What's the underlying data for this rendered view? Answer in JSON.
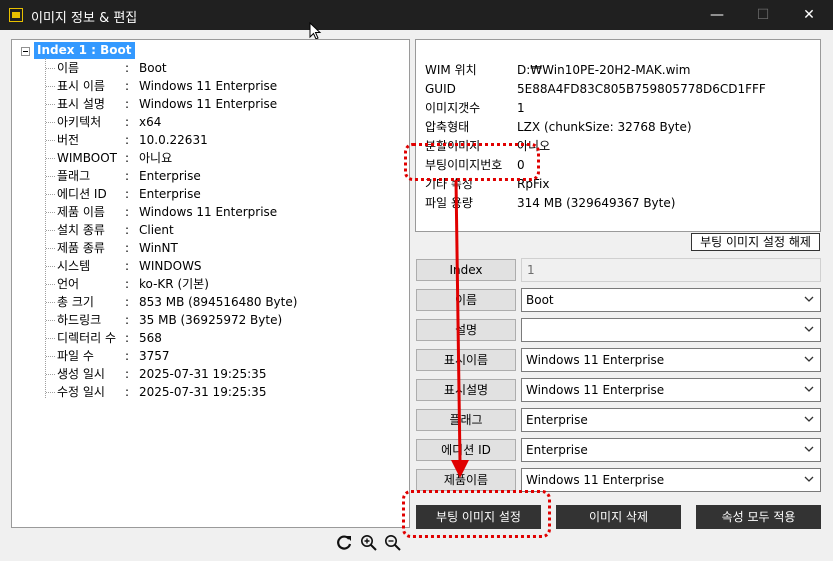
{
  "window": {
    "title": "이미지 정보 & 편집",
    "min": "—",
    "max": "☐",
    "close": "✕"
  },
  "tree": {
    "root": "Index 1 : Boot",
    "separator": ":",
    "items": [
      {
        "label": "이름",
        "value": "Boot"
      },
      {
        "label": "표시 이름",
        "value": "Windows 11 Enterprise"
      },
      {
        "label": "표시 설명",
        "value": "Windows 11 Enterprise"
      },
      {
        "label": "아키텍처",
        "value": "x64"
      },
      {
        "label": "버전",
        "value": "10.0.22631"
      },
      {
        "label": "WIMBOOT",
        "value": "아니요"
      },
      {
        "label": "플래그",
        "value": "Enterprise"
      },
      {
        "label": "에디션 ID",
        "value": "Enterprise"
      },
      {
        "label": "제품 이름",
        "value": "Windows 11 Enterprise"
      },
      {
        "label": "설치 종류",
        "value": "Client"
      },
      {
        "label": "제품 종류",
        "value": "WinNT"
      },
      {
        "label": "시스템",
        "value": "WINDOWS"
      },
      {
        "label": "언어",
        "value": "ko-KR (기본)"
      },
      {
        "label": "총 크기",
        "value": "853 MB  (894516480 Byte)"
      },
      {
        "label": "하드링크",
        "value": "35 MB  (36925972 Byte)"
      },
      {
        "label": "디렉터리 수",
        "value": "568"
      },
      {
        "label": "파일 수",
        "value": "3757"
      },
      {
        "label": "생성 일시",
        "value": "2025-07-31 19:25:35"
      },
      {
        "label": "수정 일시",
        "value": "2025-07-31 19:25:35"
      }
    ]
  },
  "info": {
    "rows": [
      {
        "key": "WIM 위치",
        "value": "D:₩Win10PE-20H2-MAK.wim"
      },
      {
        "key": "GUID",
        "value": "5E88A4FD83C805B759805778D6CD1FFF"
      },
      {
        "key": "이미지갯수",
        "value": "1"
      },
      {
        "key": "압축형태",
        "value": "LZX  (chunkSize: 32768 Byte)"
      },
      {
        "key": "분할이미지",
        "value": "아니오"
      },
      {
        "key": "부팅이미지번호",
        "value": "0"
      },
      {
        "key": "기타 속성",
        "value": "RpFix"
      },
      {
        "key": "파일 용량",
        "value": "314 MB  (329649367 Byte)"
      }
    ],
    "release_button": "부팅 이미지 설정 해제"
  },
  "fields": {
    "index": {
      "label": "Index",
      "value": "1"
    },
    "name": {
      "label": "이름",
      "value": "Boot"
    },
    "description": {
      "label": "설명",
      "value": ""
    },
    "display_name": {
      "label": "표시이름",
      "value": "Windows 11 Enterprise"
    },
    "display_description": {
      "label": "표시설명",
      "value": "Windows 11 Enterprise"
    },
    "flags": {
      "label": "플래그",
      "value": "Enterprise"
    },
    "edition_id": {
      "label": "에디션 ID",
      "value": "Enterprise"
    },
    "product_name": {
      "label": "제품이름",
      "value": "Windows 11 Enterprise"
    }
  },
  "actions": {
    "set_boot": "부팅 이미지 설정",
    "delete_image": "이미지 삭제",
    "apply_all": "속성 모두 적용"
  },
  "bottom_icons": [
    "refresh-icon",
    "zoom-in-icon",
    "zoom-out-icon"
  ],
  "colors": {
    "titlebar": "#202020",
    "selection": "#3399ff",
    "annotation": "#e00000",
    "dark_button": "#333333"
  }
}
